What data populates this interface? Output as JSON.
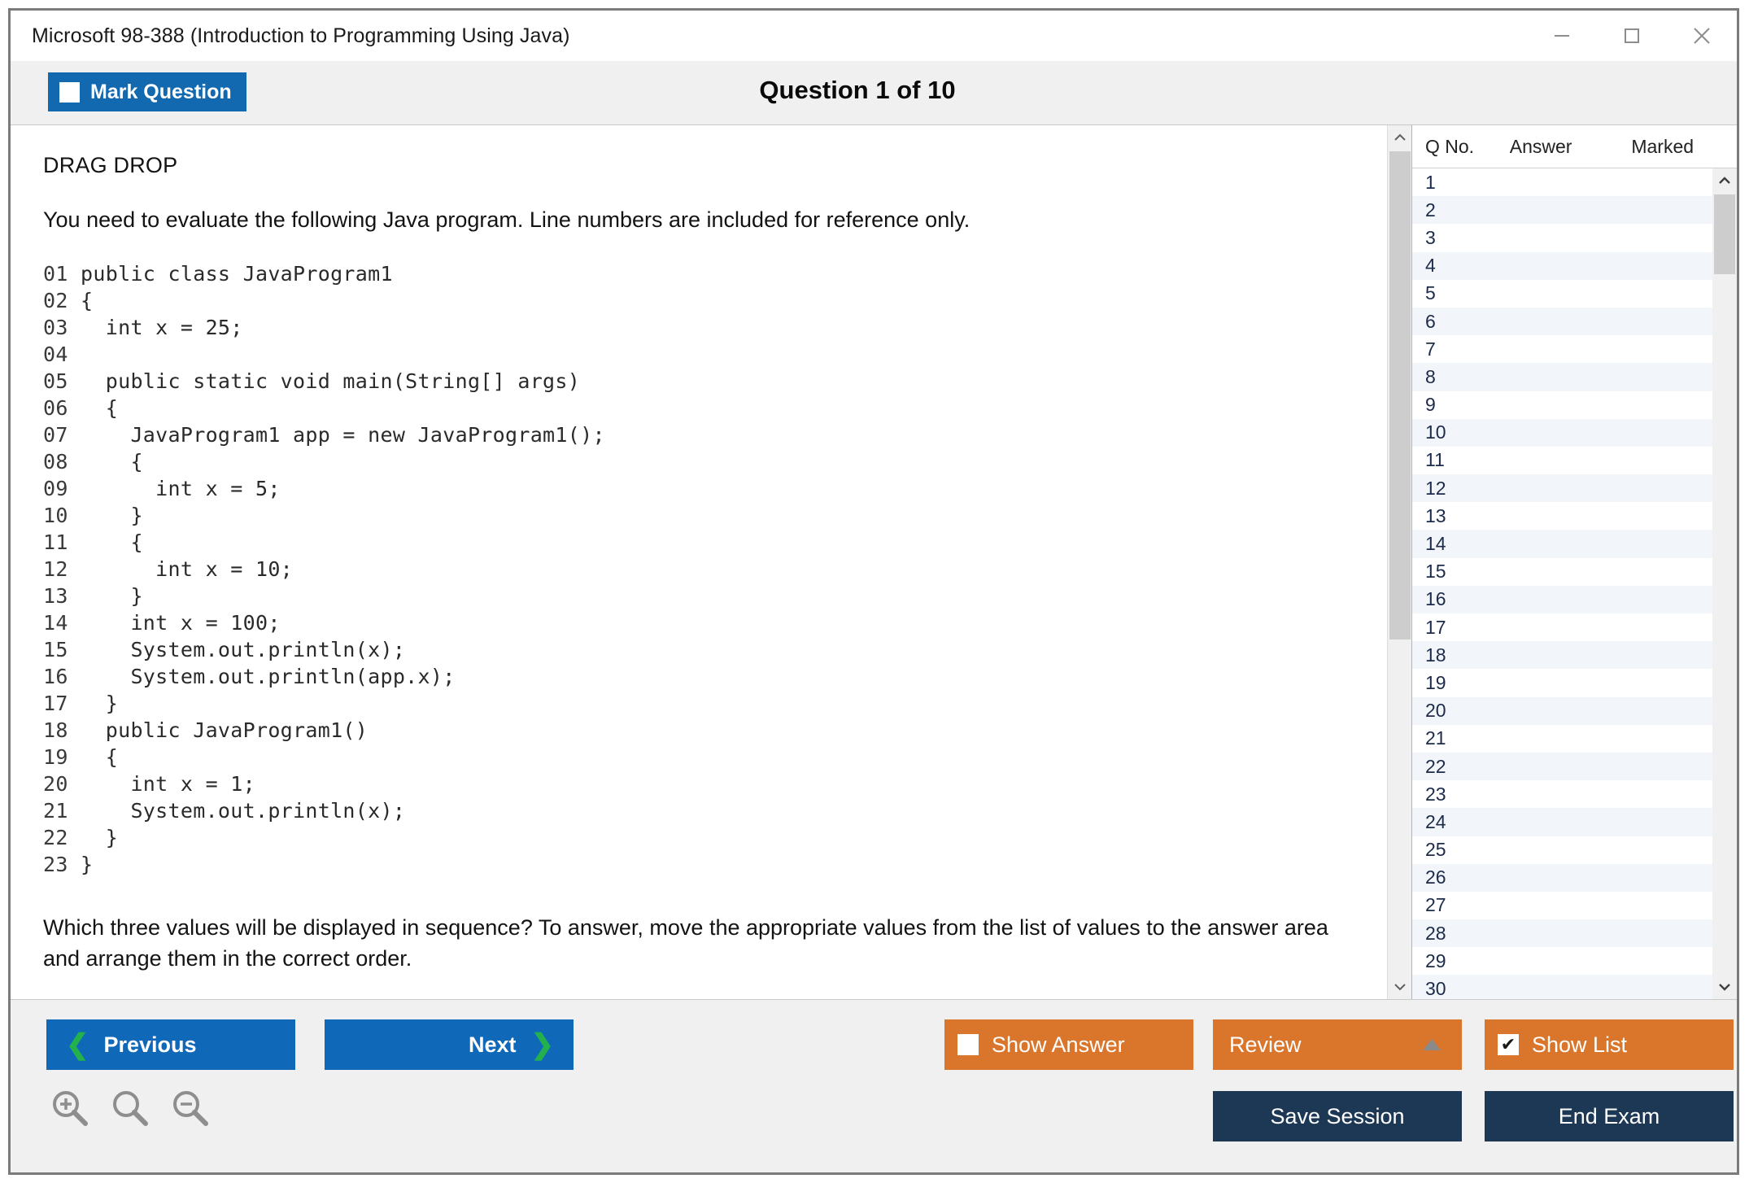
{
  "window": {
    "title": "Microsoft 98-388 (Introduction to Programming Using Java)",
    "controls": {
      "minimize": "minimize-icon",
      "maximize": "maximize-icon",
      "close": "close-icon"
    }
  },
  "toolbar": {
    "mark_question_label": "Mark Question",
    "mark_question_checked": false,
    "question_counter": "Question 1 of 10"
  },
  "content": {
    "drag_drop_label": "DRAG DROP",
    "intro_text": "You need to evaluate the following Java program. Line numbers are included for reference only.",
    "code_lines": [
      {
        "num": "01",
        "code": "public class JavaProgram1"
      },
      {
        "num": "02",
        "code": "{"
      },
      {
        "num": "03",
        "code": "  int x = 25;"
      },
      {
        "num": "04",
        "code": ""
      },
      {
        "num": "05",
        "code": "  public static void main(String[] args)"
      },
      {
        "num": "06",
        "code": "  {"
      },
      {
        "num": "07",
        "code": "    JavaProgram1 app = new JavaProgram1();"
      },
      {
        "num": "08",
        "code": "    {"
      },
      {
        "num": "09",
        "code": "      int x = 5;"
      },
      {
        "num": "10",
        "code": "    }"
      },
      {
        "num": "11",
        "code": "    {"
      },
      {
        "num": "12",
        "code": "      int x = 10;"
      },
      {
        "num": "13",
        "code": "    }"
      },
      {
        "num": "14",
        "code": "    int x = 100;"
      },
      {
        "num": "15",
        "code": "    System.out.println(x);"
      },
      {
        "num": "16",
        "code": "    System.out.println(app.x);"
      },
      {
        "num": "17",
        "code": "  }"
      },
      {
        "num": "18",
        "code": "  public JavaProgram1()"
      },
      {
        "num": "19",
        "code": "  {"
      },
      {
        "num": "20",
        "code": "    int x = 1;"
      },
      {
        "num": "21",
        "code": "    System.out.println(x);"
      },
      {
        "num": "22",
        "code": "  }"
      },
      {
        "num": "23",
        "code": "}"
      }
    ],
    "question_prompt": "Which three values will be displayed in sequence? To answer, move the appropriate values from the list of values to the answer area and arrange them in the correct order."
  },
  "list_panel": {
    "columns": [
      "Q No.",
      "Answer",
      "Marked"
    ],
    "rows": [
      {
        "qno": "1",
        "answer": "",
        "marked": ""
      },
      {
        "qno": "2",
        "answer": "",
        "marked": ""
      },
      {
        "qno": "3",
        "answer": "",
        "marked": ""
      },
      {
        "qno": "4",
        "answer": "",
        "marked": ""
      },
      {
        "qno": "5",
        "answer": "",
        "marked": ""
      },
      {
        "qno": "6",
        "answer": "",
        "marked": ""
      },
      {
        "qno": "7",
        "answer": "",
        "marked": ""
      },
      {
        "qno": "8",
        "answer": "",
        "marked": ""
      },
      {
        "qno": "9",
        "answer": "",
        "marked": ""
      },
      {
        "qno": "10",
        "answer": "",
        "marked": ""
      },
      {
        "qno": "11",
        "answer": "",
        "marked": ""
      },
      {
        "qno": "12",
        "answer": "",
        "marked": ""
      },
      {
        "qno": "13",
        "answer": "",
        "marked": ""
      },
      {
        "qno": "14",
        "answer": "",
        "marked": ""
      },
      {
        "qno": "15",
        "answer": "",
        "marked": ""
      },
      {
        "qno": "16",
        "answer": "",
        "marked": ""
      },
      {
        "qno": "17",
        "answer": "",
        "marked": ""
      },
      {
        "qno": "18",
        "answer": "",
        "marked": ""
      },
      {
        "qno": "19",
        "answer": "",
        "marked": ""
      },
      {
        "qno": "20",
        "answer": "",
        "marked": ""
      },
      {
        "qno": "21",
        "answer": "",
        "marked": ""
      },
      {
        "qno": "22",
        "answer": "",
        "marked": ""
      },
      {
        "qno": "23",
        "answer": "",
        "marked": ""
      },
      {
        "qno": "24",
        "answer": "",
        "marked": ""
      },
      {
        "qno": "25",
        "answer": "",
        "marked": ""
      },
      {
        "qno": "26",
        "answer": "",
        "marked": ""
      },
      {
        "qno": "27",
        "answer": "",
        "marked": ""
      },
      {
        "qno": "28",
        "answer": "",
        "marked": ""
      },
      {
        "qno": "29",
        "answer": "",
        "marked": ""
      },
      {
        "qno": "30",
        "answer": "",
        "marked": ""
      }
    ]
  },
  "footer": {
    "previous_label": "Previous",
    "next_label": "Next",
    "show_answer_label": "Show Answer",
    "show_answer_checked": false,
    "review_label": "Review",
    "show_list_label": "Show List",
    "show_list_checked": true,
    "show_list_check_glyph": "✔",
    "save_session_label": "Save Session",
    "end_exam_label": "End Exam",
    "zoom_in_icon": "zoom-in-icon",
    "zoom_reset_icon": "zoom-reset-icon",
    "zoom_out_icon": "zoom-out-icon"
  },
  "colors": {
    "accent_blue": "#1068b8",
    "accent_orange": "#d9762b",
    "accent_navy": "#1d3854",
    "chevron_green": "#22b14c",
    "row_alt": "#f2f6fa"
  }
}
